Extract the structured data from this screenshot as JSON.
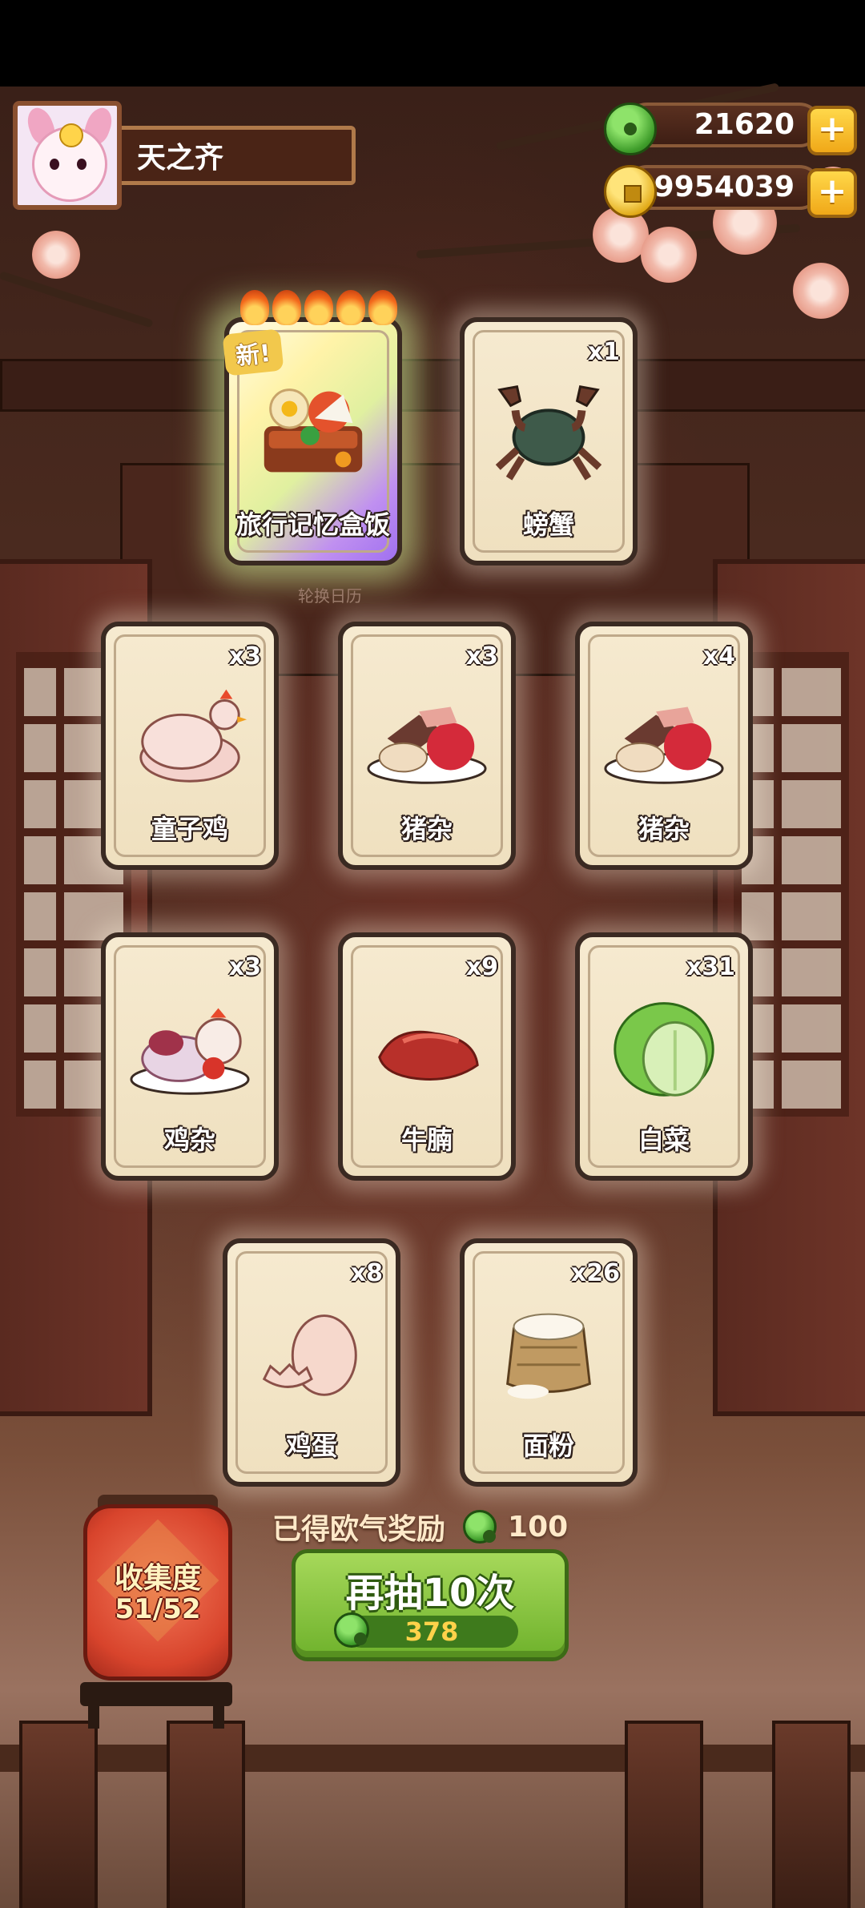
{
  "player": {
    "name": "天之齐"
  },
  "currency": {
    "jade": {
      "value": "21620",
      "icon": "jade-icon",
      "add": "+"
    },
    "coins": {
      "value": "29954039",
      "icon": "coin-icon",
      "add": "+"
    }
  },
  "featured_card": {
    "badge": "新!",
    "name": "旅行记忆盒饭",
    "rarity_flames": 5
  },
  "caption": "轮换日历",
  "cards": [
    {
      "name": "螃蟹",
      "count": "x1",
      "art": "crab"
    },
    {
      "name": "童子鸡",
      "count": "x3",
      "art": "chicken"
    },
    {
      "name": "猪杂",
      "count": "x3",
      "art": "pork"
    },
    {
      "name": "猪杂",
      "count": "x4",
      "art": "pork"
    },
    {
      "name": "鸡杂",
      "count": "x3",
      "art": "chicken-offal"
    },
    {
      "name": "牛腩",
      "count": "x9",
      "art": "beef"
    },
    {
      "name": "白菜",
      "count": "x31",
      "art": "cabbage"
    },
    {
      "name": "鸡蛋",
      "count": "x8",
      "art": "egg"
    },
    {
      "name": "面粉",
      "count": "x26",
      "art": "flour"
    }
  ],
  "reward": {
    "label": "已得欧气奖励",
    "value": "100"
  },
  "collection": {
    "label": "收集度",
    "progress": "51/52"
  },
  "draw_button": {
    "label": "再抽10次",
    "cost": "378"
  },
  "colors": {
    "accent_green": "#6fb22c",
    "gold": "#f0a818",
    "lantern_red": "#d8442c"
  }
}
